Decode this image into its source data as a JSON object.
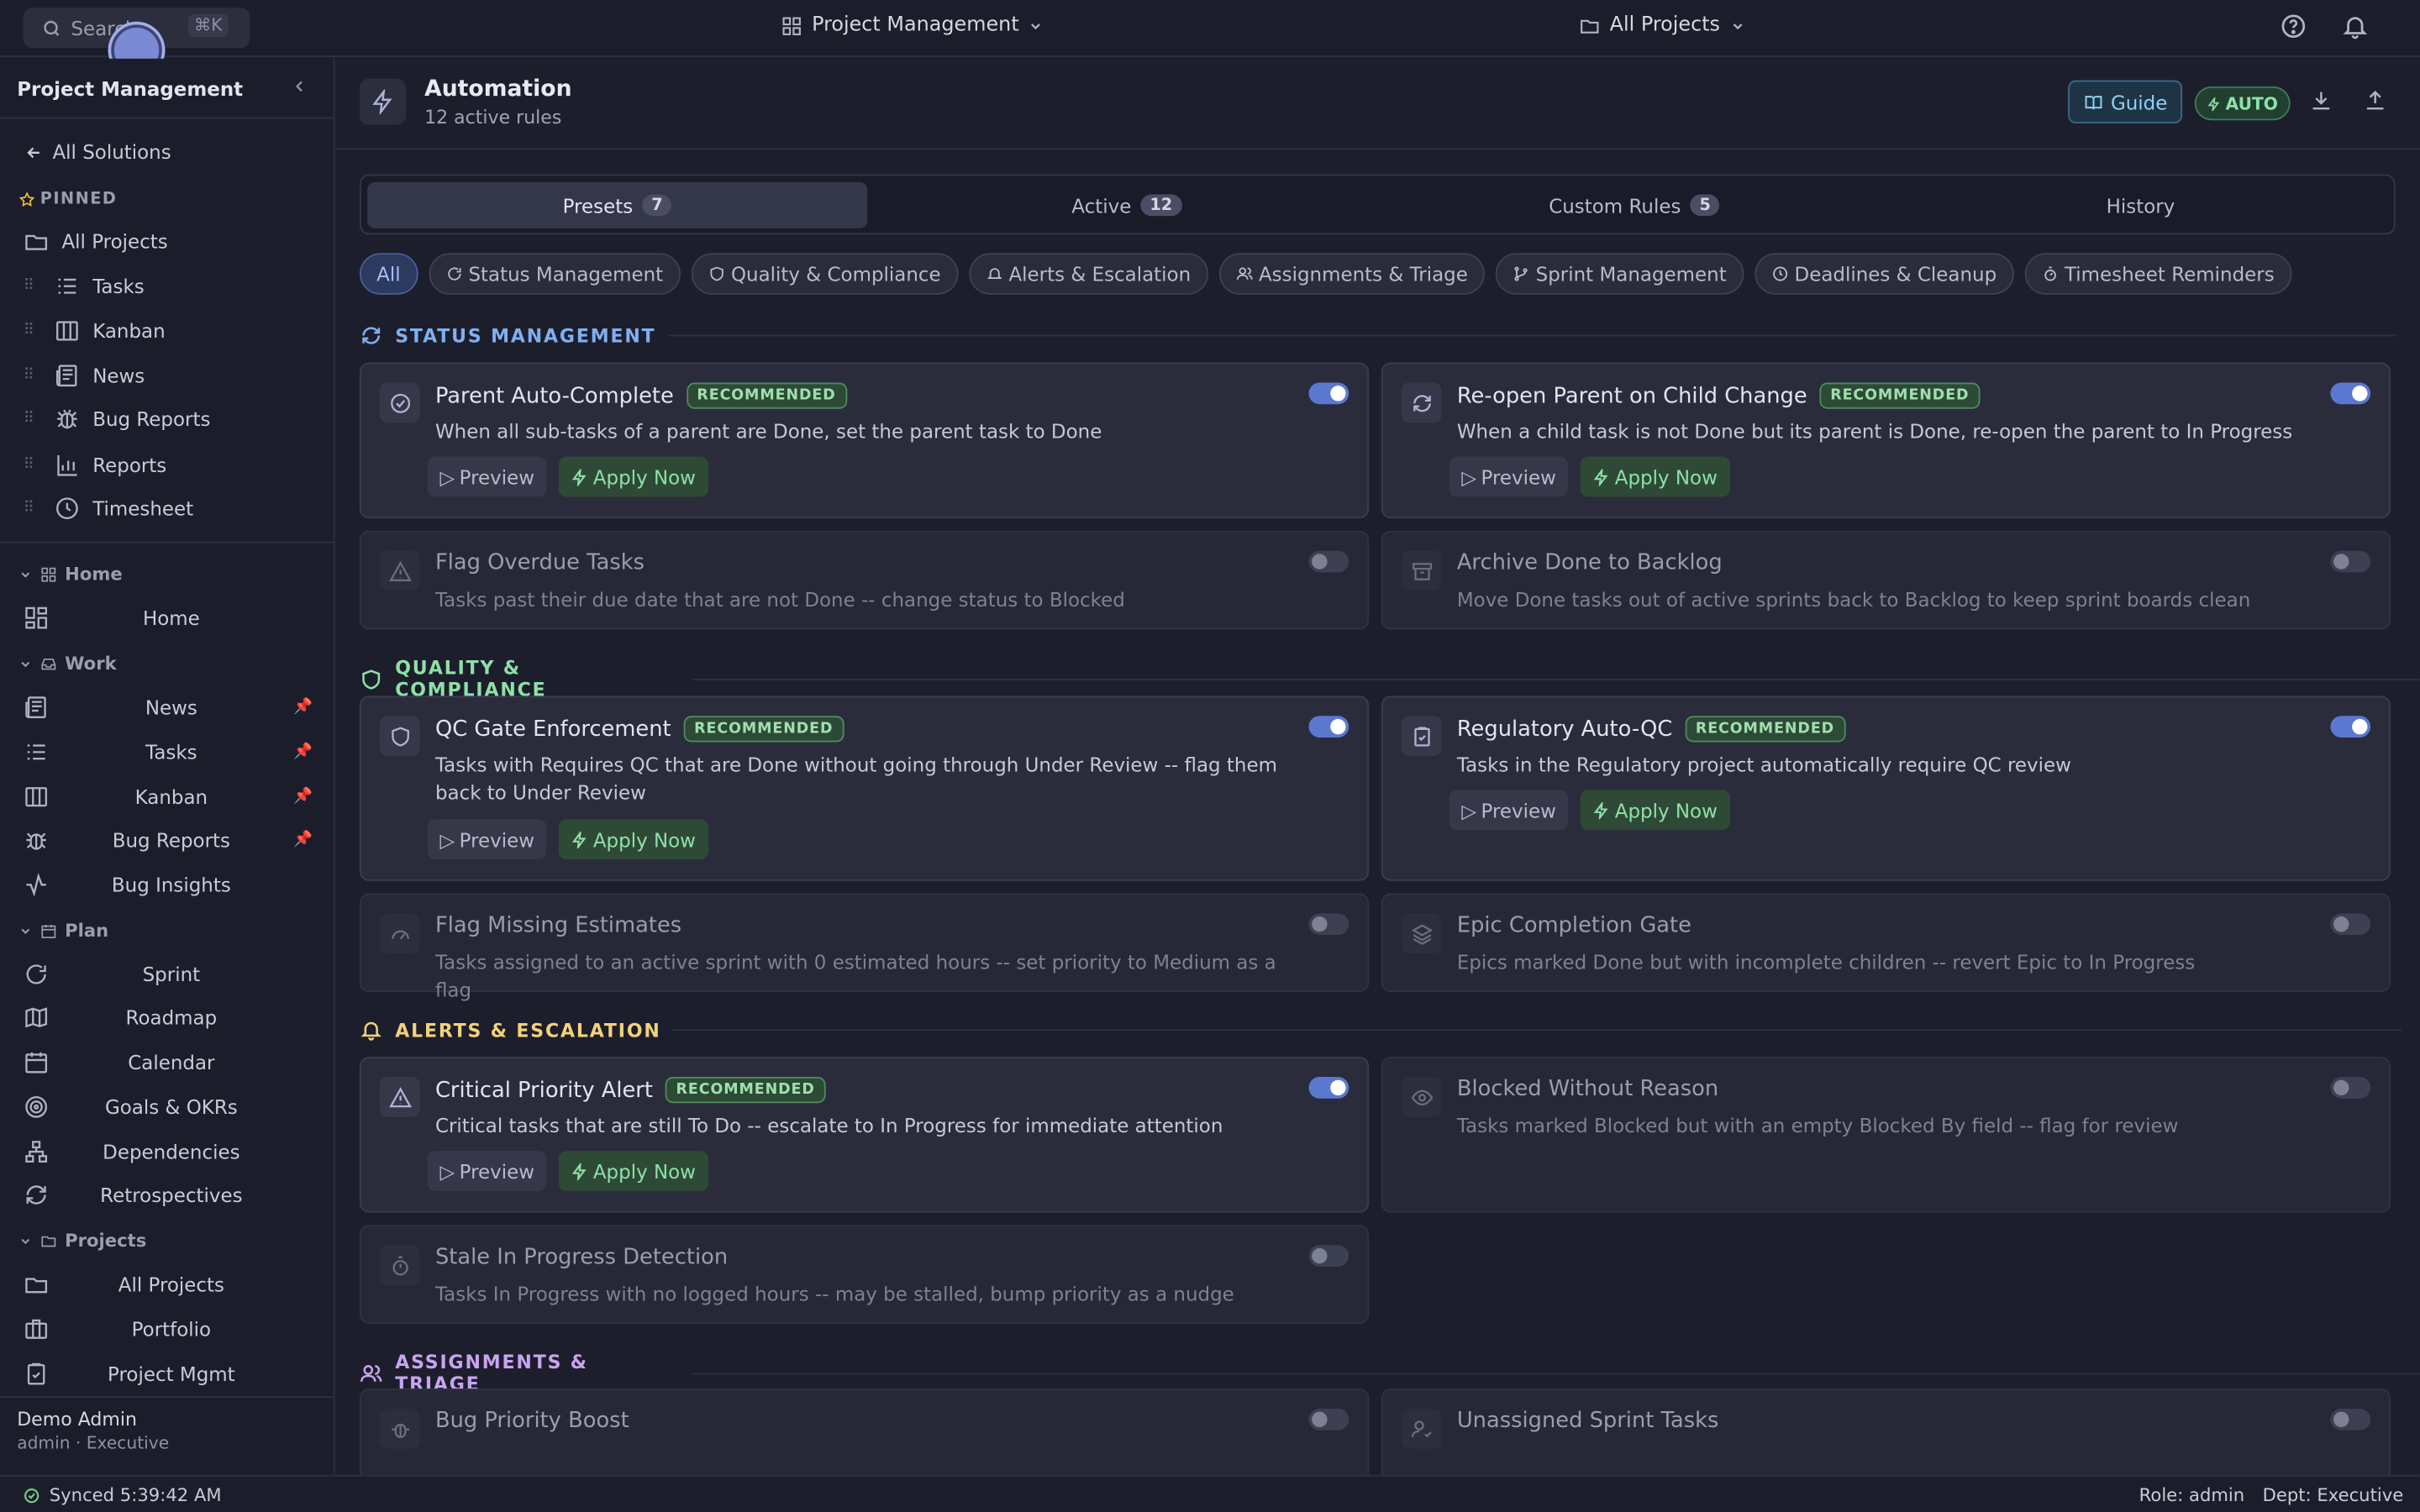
{
  "topbar": {
    "search_placeholder": "Search...",
    "search_shortcut": "⌘K",
    "solution": "Project Management",
    "scope": "All Projects"
  },
  "sidebar": {
    "title": "Project Management",
    "back": "All Solutions",
    "pinned_label": "PINNED",
    "pinned": [
      "All Projects",
      "Tasks",
      "Kanban",
      "News",
      "Bug Reports",
      "Reports",
      "Timesheet"
    ],
    "groups": {
      "home": "Home",
      "work": "Work",
      "plan": "Plan",
      "projects": "Projects"
    },
    "home_items": [
      "Home"
    ],
    "work_items": [
      "News",
      "Tasks",
      "Kanban",
      "Bug Reports",
      "Bug Insights"
    ],
    "plan_items": [
      "Sprint",
      "Roadmap",
      "Calendar",
      "Goals & OKRs",
      "Dependencies",
      "Retrospectives"
    ],
    "project_items": [
      "All Projects",
      "Portfolio",
      "Project Mgmt"
    ],
    "user": {
      "name": "Demo Admin",
      "role": "admin · Executive"
    }
  },
  "header": {
    "title": "Automation",
    "subtitle": "12 active rules",
    "guide": "Guide",
    "auto": "AUTO"
  },
  "tabs": [
    {
      "label": "Presets",
      "count": "7"
    },
    {
      "label": "Active",
      "count": "12"
    },
    {
      "label": "Custom Rules",
      "count": "5"
    },
    {
      "label": "History"
    }
  ],
  "filters": [
    "All",
    "Status Management",
    "Quality & Compliance",
    "Alerts & Escalation",
    "Assignments & Triage",
    "Sprint Management",
    "Deadlines & Cleanup",
    "Timesheet Reminders"
  ],
  "sections": {
    "status": "STATUS MANAGEMENT",
    "quality": "QUALITY & COMPLIANCE",
    "alerts": "ALERTS & ESCALATION",
    "assign": "ASSIGNMENTS & TRIAGE"
  },
  "colors": {
    "status": "#7fb0f0",
    "quality": "#8fe0a8",
    "alerts": "#f2d27a",
    "assign": "#c9a4f0"
  },
  "labels": {
    "recommended": "RECOMMENDED",
    "preview": "Preview",
    "apply": "Apply Now"
  },
  "rules": [
    {
      "name": "Parent Auto-Complete",
      "desc": "When all sub-tasks of a parent are Done, set the parent task to Done",
      "enabled": true
    },
    {
      "name": "Re-open Parent on Child Change",
      "desc": "When a child task is not Done but its parent is Done, re-open the parent to In Progress",
      "enabled": true
    },
    {
      "name": "Flag Overdue Tasks",
      "desc": "Tasks past their due date that are not Done -- change status to Blocked",
      "enabled": false
    },
    {
      "name": "Archive Done to Backlog",
      "desc": "Move Done tasks out of active sprints back to Backlog to keep sprint boards clean",
      "enabled": false
    },
    {
      "name": "QC Gate Enforcement",
      "desc": "Tasks with Requires QC that are Done without going through Under Review -- flag them back to Under Review",
      "enabled": true
    },
    {
      "name": "Regulatory Auto-QC",
      "desc": "Tasks in the Regulatory project automatically require QC review",
      "enabled": true
    },
    {
      "name": "Flag Missing Estimates",
      "desc": "Tasks assigned to an active sprint with 0 estimated hours -- set priority to Medium as a flag",
      "enabled": false
    },
    {
      "name": "Epic Completion Gate",
      "desc": "Epics marked Done but with incomplete children -- revert Epic to In Progress",
      "enabled": false
    },
    {
      "name": "Critical Priority Alert",
      "desc": "Critical tasks that are still To Do -- escalate to In Progress for immediate attention",
      "enabled": true
    },
    {
      "name": "Blocked Without Reason",
      "desc": "Tasks marked Blocked but with an empty Blocked By field -- flag for review",
      "enabled": false
    },
    {
      "name": "Stale In Progress Detection",
      "desc": "Tasks In Progress with no logged hours -- may be stalled, bump priority as a nudge",
      "enabled": false
    },
    {
      "name": "Bug Priority Boost",
      "desc": "",
      "enabled": false
    },
    {
      "name": "Unassigned Sprint Tasks",
      "desc": "",
      "enabled": false
    }
  ],
  "status": {
    "sync": "Synced 5:39:42 AM",
    "role": "Role: admin",
    "dept": "Dept: Executive"
  }
}
